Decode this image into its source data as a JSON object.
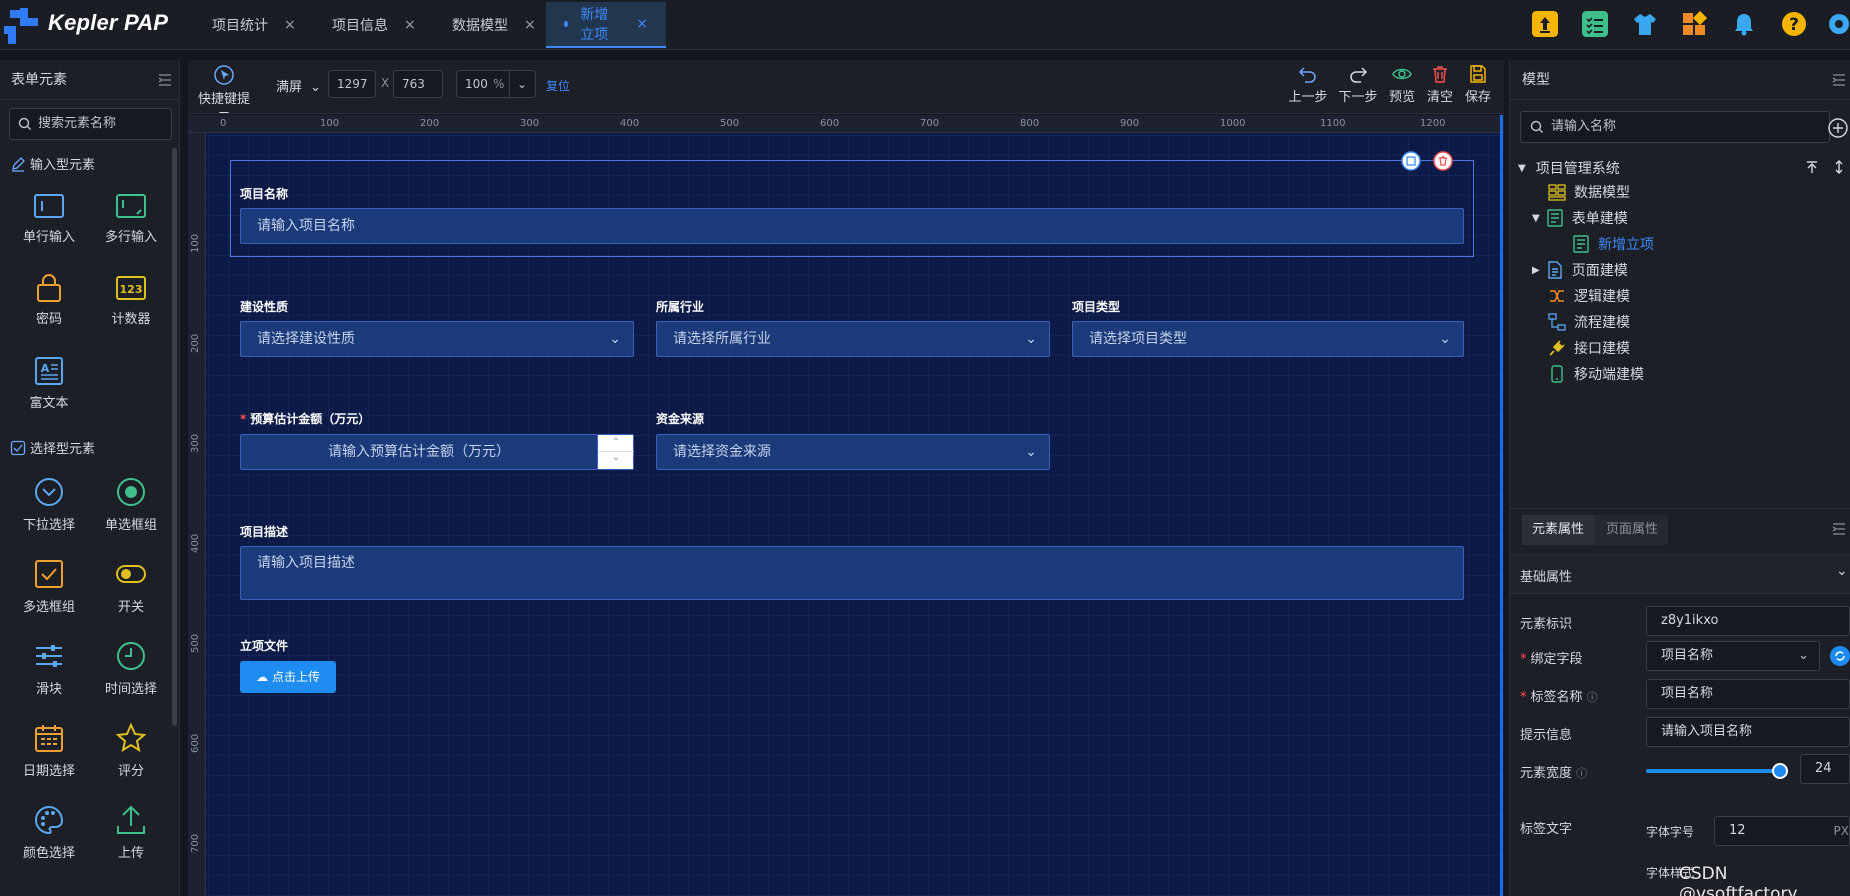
{
  "app": {
    "logo": "Kepler PAP"
  },
  "tabs": [
    {
      "label": "项目统计",
      "close": "×"
    },
    {
      "label": "项目信息",
      "close": "×"
    },
    {
      "label": "数据模型",
      "close": "×"
    },
    {
      "label": "新增立项",
      "close": "×"
    }
  ],
  "left_panel": {
    "title": "表单元素",
    "search_placeholder": "搜索元素名称",
    "input_section": "输入型元素",
    "select_section": "选择型元素",
    "input_items": [
      "单行输入",
      "多行输入",
      "密码",
      "计数器",
      "富文本"
    ],
    "select_items": [
      "下拉选择",
      "单选框组",
      "多选框组",
      "开关",
      "滑块",
      "时间选择",
      "日期选择",
      "评分",
      "颜色选择",
      "上传"
    ]
  },
  "toolbar": {
    "shortcut": "快捷键提示",
    "screen_mode": "满屏",
    "width": "1297",
    "x": "X",
    "height": "763",
    "zoom": "100",
    "zoom_unit": "%",
    "reset": "复位",
    "undo": "上一步",
    "redo": "下一步",
    "preview": "预览",
    "clear": "清空",
    "save": "保存"
  },
  "ruler": {
    "top": [
      "0",
      "100",
      "200",
      "300",
      "400",
      "500",
      "600",
      "700",
      "800",
      "900",
      "1000",
      "1100",
      "1200"
    ],
    "left": [
      "100",
      "200",
      "300",
      "400",
      "500",
      "600",
      "700"
    ]
  },
  "form": {
    "project_name": {
      "label": "项目名称",
      "placeholder": "请输入项目名称"
    },
    "construction": {
      "label": "建设性质",
      "placeholder": "请选择建设性质"
    },
    "industry": {
      "label": "所属行业",
      "placeholder": "请选择所属行业"
    },
    "project_type": {
      "label": "项目类型",
      "placeholder": "请选择项目类型"
    },
    "budget": {
      "required": "*",
      "label": "预算估计金额（万元）",
      "placeholder": "请输入预算估计金额（万元）"
    },
    "fund_source": {
      "label": "资金来源",
      "placeholder": "请选择资金来源"
    },
    "description": {
      "label": "项目描述",
      "placeholder": "请输入项目描述"
    },
    "files": {
      "label": "立项文件",
      "button": "点击上传"
    }
  },
  "right_panel": {
    "title": "模型",
    "search_placeholder": "请输入名称",
    "tree": [
      "项目管理系统",
      "数据模型",
      "表单建模",
      "新增立项",
      "页面建模",
      "逻辑建模",
      "流程建模",
      "接口建模",
      "移动端建模"
    ],
    "prop_tabs": [
      "元素属性",
      "页面属性"
    ],
    "section": "基础属性",
    "props": {
      "element_id_label": "元素标识",
      "element_id_value": "z8y1ikxo",
      "bind_field_label": "绑定字段",
      "bind_field_value": "项目名称",
      "label_name_label": "标签名称",
      "label_name_value": "项目名称",
      "hint_label": "提示信息",
      "hint_value": "请输入项目名称",
      "width_label": "元素宽度",
      "width_value": "24",
      "width_fraction": 0.96,
      "label_text_label": "标签文字",
      "font_size_label": "字体字号",
      "font_size_value": "12",
      "font_size_unit": "PX",
      "font_style_label": "字体样式"
    }
  },
  "watermark": "CSDN @vsoftfactory",
  "colors": {
    "accent": "#3d8bff",
    "canvas": "#0b1a47",
    "input_bg": "#1a3a7a",
    "upload": "#1e8bf0"
  }
}
